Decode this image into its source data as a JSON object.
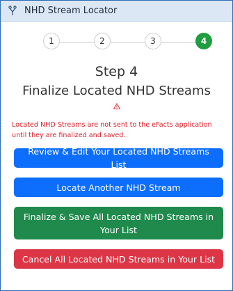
{
  "header": {
    "title": "NHD Stream Locator",
    "icon": "fork-icon"
  },
  "stepper": {
    "steps": [
      "1",
      "2",
      "3",
      "4"
    ],
    "active_step": 4,
    "active_color": "#1e9e3e"
  },
  "content": {
    "step_heading": "Step 4",
    "step_title": "Finalize Located NHD Streams",
    "warning_icon": "warning-icon",
    "warning_text": "Located NHD Streams are not sent to the eFacts application until they are finalized and saved."
  },
  "actions": {
    "review_edit": "Review & Edit Your Located NHD Streams List",
    "locate_another": "Locate Another NHD Stream",
    "finalize_save": "Finalize & Save All Located NHD Streams in Your List",
    "cancel_all": "Cancel All Located NHD Streams in Your List"
  },
  "colors": {
    "primary": "#0d6efd",
    "success": "#1f8a4c",
    "danger": "#dc3545",
    "warning_text": "#d9232d"
  }
}
